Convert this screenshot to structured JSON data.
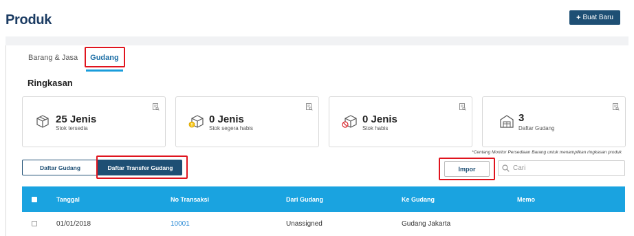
{
  "header": {
    "title": "Produk",
    "new_button": "Buat Baru",
    "new_icon": "plus-icon"
  },
  "tabs": [
    {
      "label": "Barang & Jasa",
      "active": false
    },
    {
      "label": "Gudang",
      "active": true
    }
  ],
  "summary": {
    "title": "Ringkasan",
    "cards": [
      {
        "value": "25 Jenis",
        "sub": "Stok tersedia",
        "icon": "box-icon"
      },
      {
        "value": "0 Jenis",
        "sub": "Stok segera habis",
        "icon": "box-warning-icon"
      },
      {
        "value": "0 Jenis",
        "sub": "Stok habis",
        "icon": "box-empty-icon"
      },
      {
        "value": "3",
        "sub": "Daftar Gudang",
        "icon": "warehouse-icon"
      }
    ],
    "note": "*Centang Monitor Persediaan Barang untuk menampilkan ringkasan produk"
  },
  "toggle": {
    "list_label": "Daftar Gudang",
    "transfer_label": "Daftar Transfer Gudang",
    "active": "transfer"
  },
  "actions": {
    "import_label": "Impor",
    "search_placeholder": "Cari"
  },
  "table": {
    "headers": [
      "Tanggal",
      "No Transaksi",
      "Dari Gudang",
      "Ke Gudang",
      "Memo"
    ],
    "rows": [
      {
        "tanggal": "01/01/2018",
        "no_transaksi": "10001",
        "dari": "Unassigned",
        "ke": "Gudang Jakarta",
        "memo": ""
      }
    ]
  },
  "colors": {
    "primary": "#1e4f74",
    "accent": "#1aa3e0",
    "link": "#2a8ad5",
    "highlight": "#e0141e"
  }
}
